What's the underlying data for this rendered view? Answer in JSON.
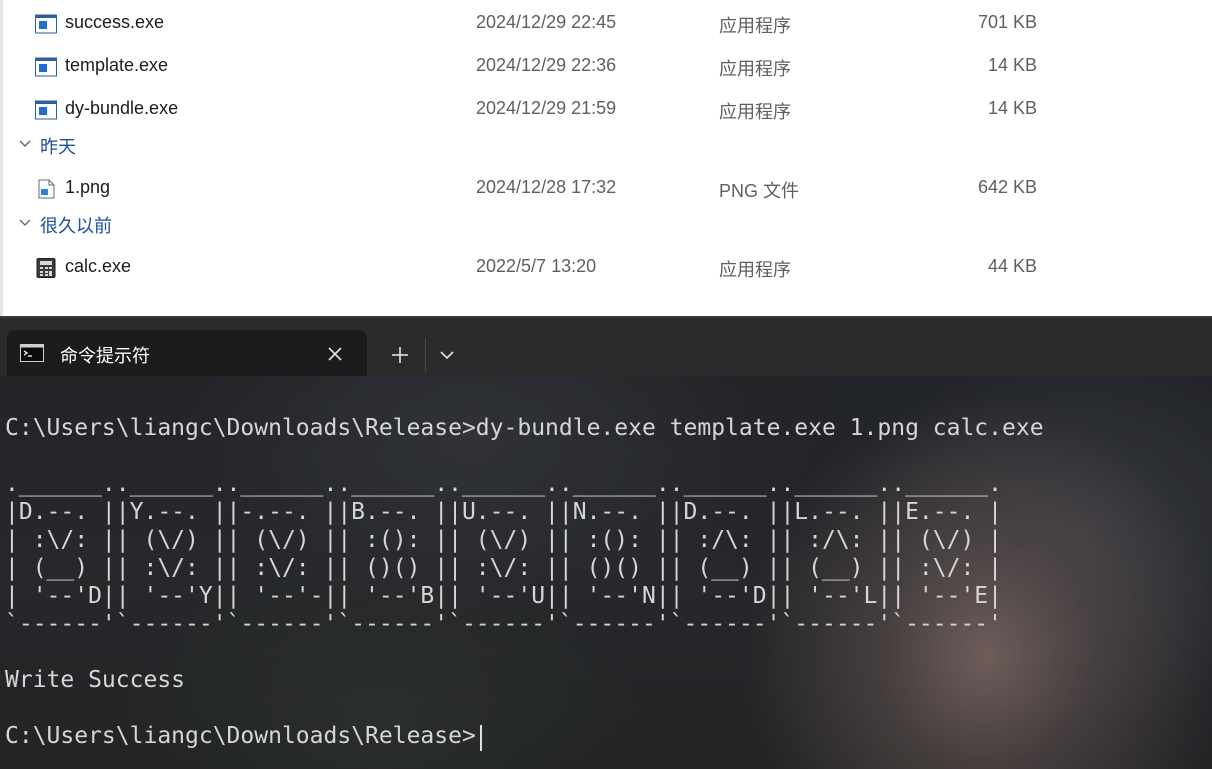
{
  "explorer": {
    "rows": [
      {
        "kind": "file",
        "icon": "exe-app-icon",
        "name": "success.exe",
        "date": "2024/12/29 22:45",
        "type": "应用程序",
        "size": "701 KB"
      },
      {
        "kind": "file",
        "icon": "exe-app-icon",
        "name": "template.exe",
        "date": "2024/12/29 22:36",
        "type": "应用程序",
        "size": "14 KB"
      },
      {
        "kind": "file",
        "icon": "exe-app-icon",
        "name": "dy-bundle.exe",
        "date": "2024/12/29 21:59",
        "type": "应用程序",
        "size": "14 KB"
      },
      {
        "kind": "group",
        "label": "昨天"
      },
      {
        "kind": "file",
        "icon": "png-image-icon",
        "name": "1.png",
        "date": "2024/12/28 17:32",
        "type": "PNG 文件",
        "size": "642 KB"
      },
      {
        "kind": "group",
        "label": "很久以前"
      },
      {
        "kind": "file",
        "icon": "calculator-icon",
        "name": "calc.exe",
        "date": "2022/5/7 13:20",
        "type": "应用程序",
        "size": "44 KB"
      }
    ]
  },
  "terminal": {
    "tab_title": "命令提示符",
    "tab_icon": "cmd-icon",
    "lines": [
      "C:\\Users\\liangc\\Downloads\\Release>dy-bundle.exe template.exe 1.png calc.exe",
      "",
      ".______..______..______..______..______..______..______..______..______.",
      "|D.--. ||Y.--. ||-.--. ||B.--. ||U.--. ||N.--. ||D.--. ||L.--. ||E.--. |",
      "| :\\/: || (\\/) || (\\/) || :(): || (\\/) || :(): || :/\\: || :/\\: || (\\/) |",
      "| (__) || :\\/: || :\\/: || ()() || :\\/: || ()() || (__) || (__) || :\\/: |",
      "| '--'D|| '--'Y|| '--'-|| '--'B|| '--'U|| '--'N|| '--'D|| '--'L|| '--'E|",
      "`------'`------'`------'`------'`------'`------'`------'`------'`------'",
      "",
      "Write Success",
      "",
      "C:\\Users\\liangc\\Downloads\\Release>"
    ]
  },
  "colors": {
    "group_header": "#1a4f9c",
    "terminal_text": "#d6d6d6",
    "tab_bar": "#2b2b2b",
    "active_tab": "#1c1c1c"
  }
}
